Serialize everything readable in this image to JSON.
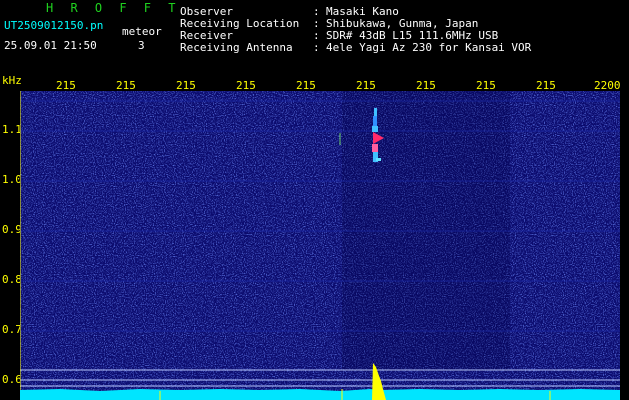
{
  "app": {
    "title": "H R O F F T",
    "filename": "UT2509012150.pn",
    "meteor_label": "meteor",
    "date_time": "25.09.01 21:50",
    "meteor_count": "3"
  },
  "info": {
    "labels": [
      "Observer",
      "Receiving Location",
      "Receiver",
      "Receiving Antenna"
    ],
    "separator": ":",
    "values": [
      "Masaki Kano",
      "Shibukawa, Gunma, Japan",
      "SDR# 43dB L15 111.6MHz USB",
      "4ele Yagi Az 230 for Kansai VOR"
    ]
  },
  "axes": {
    "y_unit": "kHz",
    "y_ticks": [
      "1.1",
      "1.0",
      "0.9",
      "0.8",
      "0.7",
      "0.6"
    ],
    "x_ticks": [
      "215",
      "215",
      "215",
      "215",
      "215",
      "215",
      "215",
      "215",
      "215",
      "2200"
    ]
  },
  "colors": {
    "background": "#000000",
    "noise_bg": "#0b0b6e",
    "title": "#1fd21f",
    "tick_text": "#ffff00",
    "baseline": "#00e5ff",
    "meteor": "#ff2a6a"
  }
}
